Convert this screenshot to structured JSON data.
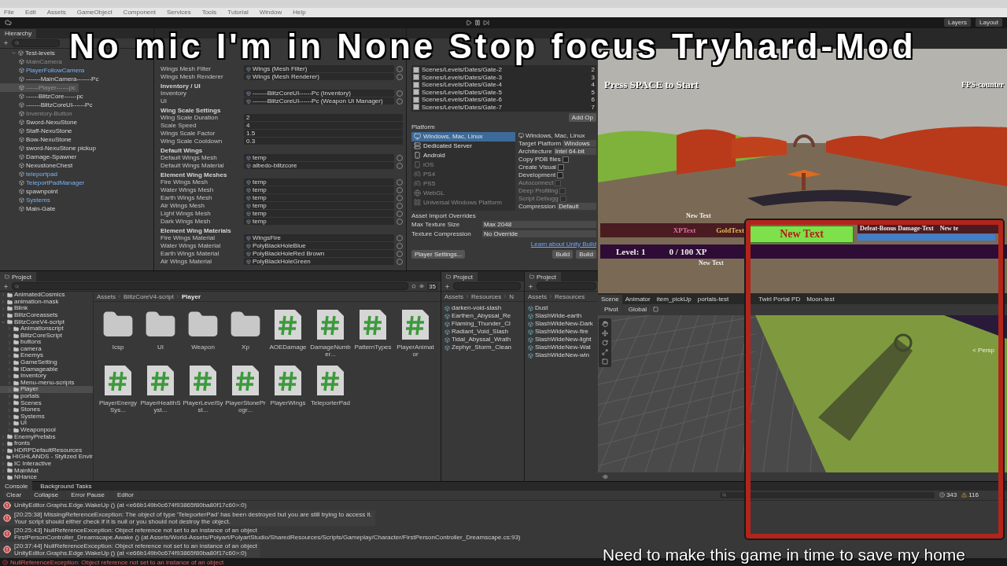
{
  "menu_bar": [
    "File",
    "Edit",
    "Assets",
    "GameObject",
    "Component",
    "Services",
    "Tools",
    "Tutorial",
    "Window",
    "Help"
  ],
  "toolbar": {
    "right_buttons": [
      "Layers",
      "Layout"
    ]
  },
  "caption_top": "No mic I'm in None Stop focus Tryhard-Mod",
  "caption_bottom": "Need to make this game in time to save my home",
  "hierarchy": {
    "title": "Hierarchy",
    "items": [
      {
        "label": "Test-levels",
        "prefab": false,
        "disabled": false,
        "selected": false,
        "children": [
          {
            "label": "MainCamera",
            "prefab": false,
            "disabled": true,
            "selected": false
          },
          {
            "label": "PlayerFollowCamera",
            "prefab": true,
            "disabled": false,
            "selected": false
          },
          {
            "label": "-------MainCamera-------Pc",
            "prefab": false,
            "disabled": false,
            "selected": false
          },
          {
            "label": "------Player------pc",
            "prefab": false,
            "disabled": true,
            "selected": true
          },
          {
            "label": "------BlitzCore------pc",
            "prefab": false,
            "disabled": false,
            "selected": false
          },
          {
            "label": "-------BlitzCoreUI------Pc",
            "prefab": false,
            "disabled": false,
            "selected": false
          },
          {
            "label": "Inventory-Button",
            "prefab": false,
            "disabled": true,
            "selected": false
          },
          {
            "label": "Sword-NexuStone",
            "prefab": false,
            "disabled": false,
            "selected": false
          },
          {
            "label": "Staff-NexuStone",
            "prefab": false,
            "disabled": false,
            "selected": false
          },
          {
            "label": "Bow-NexuStone",
            "prefab": false,
            "disabled": false,
            "selected": false
          },
          {
            "label": "sword-NexuStone pickup",
            "prefab": false,
            "disabled": false,
            "selected": false
          },
          {
            "label": "Damage-Spawner",
            "prefab": false,
            "disabled": false,
            "selected": false
          },
          {
            "label": "NexustoneChest",
            "prefab": false,
            "disabled": false,
            "selected": false
          },
          {
            "label": "teleportpad",
            "prefab": true,
            "disabled": false,
            "selected": false
          },
          {
            "label": "TeleportPadManager",
            "prefab": true,
            "disabled": false,
            "selected": false
          },
          {
            "label": "spawnpoint",
            "prefab": false,
            "disabled": false,
            "selected": false
          },
          {
            "label": "Systems",
            "prefab": true,
            "disabled": false,
            "selected": false
          },
          {
            "label": "Main-Gate",
            "prefab": false,
            "disabled": false,
            "selected": false
          }
        ]
      }
    ]
  },
  "inspector": {
    "sections": [
      {
        "rows": [
          {
            "label": "Wings Mesh Filter",
            "kind": "object",
            "value": "Wings (Mesh Filter)"
          },
          {
            "label": "Wings Mesh Renderer",
            "kind": "object",
            "value": "Wings (Mesh Renderer)"
          }
        ]
      },
      {
        "title": "Inventory / UI",
        "rows": [
          {
            "label": "Inventory",
            "kind": "object",
            "value": "-------BlitzCoreUI------Pc (Inventory)"
          },
          {
            "label": "UI",
            "kind": "object",
            "value": "-------BlitzCoreUI------Pc (Weapon UI Manager)"
          }
        ]
      },
      {
        "title": "Wing Scale Settings",
        "rows": [
          {
            "label": "Wing Scale Duration",
            "kind": "number",
            "value": "2"
          },
          {
            "label": "Scale Speed",
            "kind": "number",
            "value": "4"
          },
          {
            "label": "Wings Scale Factor",
            "kind": "number",
            "value": "1.5"
          },
          {
            "label": "Wing Scale Cooldown",
            "kind": "number",
            "value": "0.3"
          }
        ]
      },
      {
        "title": "Default Wings",
        "rows": [
          {
            "label": "Default Wings Mesh",
            "kind": "object",
            "value": "temp"
          },
          {
            "label": "Default Wings Material",
            "kind": "object",
            "value": "albedo-blitzcore"
          }
        ]
      },
      {
        "title": "Element Wing Meshes",
        "rows": [
          {
            "label": "Fire Wings Mesh",
            "kind": "object",
            "value": "temp"
          },
          {
            "label": "Water Wings Mesh",
            "kind": "object",
            "value": "temp"
          },
          {
            "label": "Earth Wings Mesh",
            "kind": "object",
            "value": "temp"
          },
          {
            "label": "Air Wings Mesh",
            "kind": "object",
            "value": "temp"
          },
          {
            "label": "Light Wings Mesh",
            "kind": "object",
            "value": "temp"
          },
          {
            "label": "Dark Wings Mesh",
            "kind": "object",
            "value": "temp"
          }
        ]
      },
      {
        "title": "Element Wing Materials",
        "rows": [
          {
            "label": "Fire Wings Material",
            "kind": "object",
            "value": "WingsFire"
          },
          {
            "label": "Water Wings Material",
            "kind": "object",
            "value": "PolyBlackHoleBlue"
          },
          {
            "label": "Earth Wings Material",
            "kind": "object",
            "value": "PolyBlackHoleRed Brown"
          },
          {
            "label": "Air Wings Material",
            "kind": "object",
            "value": "PolyBlackHoleGreen"
          }
        ]
      }
    ]
  },
  "build_settings": {
    "scenes": [
      {
        "path": "Scenes/Levels/Dates/Gate-2",
        "index": "2",
        "checked": true
      },
      {
        "path": "Scenes/Levels/Dates/Gate-3",
        "index": "3",
        "checked": true
      },
      {
        "path": "Scenes/Levels/Dates/Gate-4",
        "index": "4",
        "checked": true
      },
      {
        "path": "Scenes/Levels/Dates/Gate-5",
        "index": "5",
        "checked": true
      },
      {
        "path": "Scenes/Levels/Dates/Gate-6",
        "index": "6",
        "checked": true
      },
      {
        "path": "Scenes/Levels/Dates/Gate-7",
        "index": "7",
        "checked": true
      }
    ],
    "add_button": "Add Op",
    "platform_label": "Platform",
    "platforms": [
      {
        "label": "Windows, Mac, Linux",
        "kind": "desktop",
        "selected": true,
        "disabled": false
      },
      {
        "label": "Dedicated Server",
        "kind": "server",
        "selected": false,
        "disabled": false
      },
      {
        "label": "Android",
        "kind": "mobile",
        "selected": false,
        "disabled": false
      },
      {
        "label": "iOS",
        "kind": "mobile",
        "selected": false,
        "disabled": true
      },
      {
        "label": "PS4",
        "kind": "console",
        "selected": false,
        "disabled": true
      },
      {
        "label": "PS5",
        "kind": "console",
        "selected": false,
        "disabled": true
      },
      {
        "label": "WebGL",
        "kind": "web",
        "selected": false,
        "disabled": true
      },
      {
        "label": "Universal Windows Platform",
        "kind": "windows",
        "selected": false,
        "disabled": true
      }
    ],
    "settings_title": "Windows, Mac, Linux",
    "settings": [
      {
        "label": "Target Platform",
        "kind": "dropdown",
        "value": "Windows",
        "disabled": false
      },
      {
        "label": "Architecture",
        "kind": "dropdown",
        "value": "Intel 64-bit",
        "disabled": false
      },
      {
        "label": "Copy PDB files",
        "kind": "checkbox",
        "checked": false,
        "disabled": false
      },
      {
        "label": "Create Visual",
        "kind": "checkbox",
        "checked": false,
        "disabled": false
      },
      {
        "label": "Development",
        "kind": "checkbox",
        "checked": false,
        "disabled": false
      },
      {
        "label": "Autoconnect",
        "kind": "checkbox",
        "checked": false,
        "disabled": true
      },
      {
        "label": "Deep Profiling",
        "kind": "checkbox",
        "checked": false,
        "disabled": true
      },
      {
        "label": "Script Debugg",
        "kind": "checkbox",
        "checked": false,
        "disabled": true
      },
      {
        "label": "Compression",
        "kind": "dropdown",
        "value": "Default",
        "disabled": false
      }
    ],
    "overrides_title": "Asset Import Overrides",
    "overrides": [
      {
        "label": "Max Texture Size",
        "value": "Max 2048"
      },
      {
        "label": "Texture Compression",
        "value": "No Override"
      }
    ],
    "link": "Learn about Unity Build",
    "player_settings_button": "Player Settings...",
    "build_buttons": [
      "Build",
      "Build"
    ]
  },
  "project": {
    "title": "Project",
    "count": "35",
    "breadcrumb": [
      "Assets",
      "BlitzCoreV4-script",
      "Player"
    ],
    "tree": [
      {
        "label": "AnimatedCosmics",
        "selected": false
      },
      {
        "label": "animation-mask",
        "selected": false
      },
      {
        "label": "Blink",
        "selected": false
      },
      {
        "label": "BlitzCoreassets",
        "selected": false
      },
      {
        "label": "BlitzCoreV4-script",
        "selected": false,
        "children": [
          {
            "label": "Animationscript",
            "selected": false
          },
          {
            "label": "BlitzCoreScript",
            "selected": false
          },
          {
            "label": "buttons",
            "selected": false
          },
          {
            "label": "camera",
            "selected": false
          },
          {
            "label": "Enemys",
            "selected": false
          },
          {
            "label": "GameSetting",
            "selected": false
          },
          {
            "label": "IDamageable",
            "selected": false
          },
          {
            "label": "Inventory",
            "selected": false
          },
          {
            "label": "Menu-menu-scripts",
            "selected": false
          },
          {
            "label": "Player",
            "selected": true
          },
          {
            "label": "portals",
            "selected": false
          },
          {
            "label": "Scenes",
            "selected": false
          },
          {
            "label": "Stones",
            "selected": false
          },
          {
            "label": "Systems",
            "selected": false
          },
          {
            "label": "UI",
            "selected": false
          },
          {
            "label": "Weaponpool",
            "selected": false
          }
        ]
      },
      {
        "label": "EnemyPrefabs",
        "selected": false
      },
      {
        "label": "fronts",
        "selected": false
      },
      {
        "label": "HDRPDefaultResources",
        "selected": false
      },
      {
        "label": "HIGHLANDS - Stylized Envir",
        "selected": false
      },
      {
        "label": "IC Interactive",
        "selected": false
      },
      {
        "label": "MainMat",
        "selected": false
      },
      {
        "label": "NHance",
        "selected": false
      }
    ],
    "assets": [
      {
        "name": "Icsp",
        "kind": "folder"
      },
      {
        "name": "UI",
        "kind": "folder"
      },
      {
        "name": "Weapon",
        "kind": "folder"
      },
      {
        "name": "Xp",
        "kind": "folder"
      },
      {
        "name": "AOEDamage",
        "kind": "script"
      },
      {
        "name": "DamageNumber...",
        "kind": "script"
      },
      {
        "name": "PatternTypes",
        "kind": "script"
      },
      {
        "name": "PlayerAnimator",
        "kind": "script"
      },
      {
        "name": "PlayerEnergySys...",
        "kind": "script"
      },
      {
        "name": "PlayerHealthSyst...",
        "kind": "script"
      },
      {
        "name": "PlayerLevelSyst...",
        "kind": "script"
      },
      {
        "name": "PlayerStoneProgr...",
        "kind": "script"
      },
      {
        "name": "PlayerWings",
        "kind": "script"
      },
      {
        "name": "TeleporterPad",
        "kind": "script"
      }
    ]
  },
  "project_small": [
    {
      "title": "Project",
      "breadcrumb": [
        "Assets",
        "Resources",
        "N"
      ],
      "items": [
        "darken-void-slash",
        "Earthen_Abyssal_Re",
        "Flaming_Thunder_Cl",
        "Radiant_Void_Slash",
        "Tidal_Abyssal_Wrath",
        "Zephyr_Storm_Clean"
      ]
    },
    {
      "title": "Project",
      "breadcrumb": [
        "Assets",
        "Resources"
      ],
      "items": [
        "Dust",
        "SlashWide-earth",
        "SlashWideNew-Dark",
        "SlashWideNew-fire",
        "SlashWideNew-light",
        "SlashWideNew-Wat",
        "SlashWideNew-win"
      ]
    }
  ],
  "game": {
    "start_prompt": "Press SPACE to Start",
    "fps": "FPS-counter",
    "float_text": "New Text",
    "xp_text": "XPText",
    "gold_text": "GoldText",
    "center_text": "New Text",
    "defeat_text": "Defeat-Bonus Damage-Text",
    "extra_text": "New te",
    "level": "Level: 1",
    "xp": "0 / 100 XP",
    "bottom_text": "New Text"
  },
  "scene": {
    "tabs": [
      {
        "label": "Scene",
        "selected": true
      },
      {
        "label": "Animator",
        "selected": false
      },
      {
        "label": "item_pickUp",
        "selected": false
      },
      {
        "label": "portals-test",
        "selected": false
      },
      {
        "label": "Twirl Portal PD",
        "selected": false
      },
      {
        "label": "Moon-test",
        "selected": false
      }
    ],
    "pivot": "Pivot",
    "space": "Global",
    "view_label": "< Persp"
  },
  "console": {
    "tabs": [
      "Console",
      "Background Tasks"
    ],
    "buttons": [
      "Clear",
      "Collapse",
      "Error Pause",
      "Editor"
    ],
    "error_count": "343",
    "warning_count": "116",
    "messages": [
      {
        "lines": [
          "UnityEditor.Graphs.Edge.WakeUp () (at <e66b149b0c674f93865f80ba80f17c60>:0)"
        ]
      },
      {
        "lines": [
          "[20:25:38] MissingReferenceException: The object of type 'TeleporterPad' has been destroyed but you are still trying to access it.",
          "Your script should either check if it is null or you should not destroy the object."
        ]
      },
      {
        "lines": [
          "[20:25:43] NullReferenceException: Object reference not set to an instance of an object",
          "FirstPersonController_Dreamscape.Awake () (at Assets/World-Assets/Polyart/PolyartStudio/SharedResources/Scripts/Gameplay/Character/FirstPersonController_Dreamscape.cs:93)"
        ]
      },
      {
        "lines": [
          "[20:37:44] NullReferenceException: Object reference not set to an instance of an object",
          "UnityEditor.Graphs.Edge.WakeUp () (at <e66b149b0c674f93865f80ba80f17c60>:0)"
        ]
      }
    ]
  },
  "status_bar": "NullReferenceException: Object reference not set to an instance of an object"
}
